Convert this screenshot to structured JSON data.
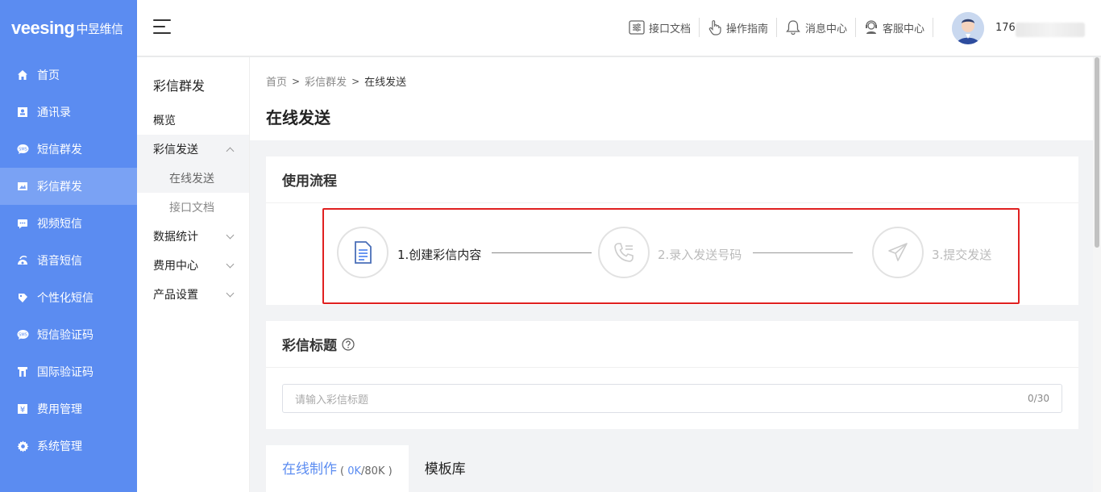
{
  "logo": {
    "brand": "veesing",
    "cn": "中昱维信"
  },
  "sidebar": {
    "items": [
      {
        "label": "首页",
        "icon": "home-icon"
      },
      {
        "label": "通讯录",
        "icon": "contacts-icon"
      },
      {
        "label": "短信群发",
        "icon": "sms-icon"
      },
      {
        "label": "彩信群发",
        "icon": "mms-icon",
        "active": true
      },
      {
        "label": "视频短信",
        "icon": "video-sms-icon"
      },
      {
        "label": "语音短信",
        "icon": "voice-sms-icon"
      },
      {
        "label": "个性化短信",
        "icon": "personalized-sms-icon"
      },
      {
        "label": "短信验证码",
        "icon": "sms-code-icon"
      },
      {
        "label": "国际验证码",
        "icon": "intl-code-icon"
      },
      {
        "label": "费用管理",
        "icon": "yen-icon"
      },
      {
        "label": "系统管理",
        "icon": "gear-icon"
      }
    ]
  },
  "header": {
    "links": [
      {
        "label": "接口文档",
        "icon": "api-doc-icon"
      },
      {
        "label": "操作指南",
        "icon": "hand-pointer-icon"
      },
      {
        "label": "消息中心",
        "icon": "bell-icon"
      },
      {
        "label": "客服中心",
        "icon": "support-icon"
      }
    ],
    "user_phone": "176"
  },
  "subnav": {
    "title": "彩信群发",
    "overview": "概览",
    "send_group": "彩信发送",
    "send_children": [
      "在线发送",
      "接口文档"
    ],
    "stats": "数据统计",
    "billing": "费用中心",
    "product": "产品设置"
  },
  "page": {
    "breadcrumb": [
      "首页",
      "彩信群发",
      "在线发送"
    ],
    "title": "在线发送"
  },
  "flow": {
    "heading": "使用流程",
    "steps": [
      "1.创建彩信内容",
      "2.录入发送号码",
      "3.提交发送"
    ]
  },
  "mms_title": {
    "heading": "彩信标题",
    "placeholder": "请输入彩信标题",
    "counter": "0/30"
  },
  "tabs": {
    "online": "在线制作",
    "size_used": "0K",
    "size_total": "/80K",
    "library": "模板库"
  },
  "colors": {
    "brand": "#5b8cf1",
    "highlight_border": "#e02020"
  }
}
